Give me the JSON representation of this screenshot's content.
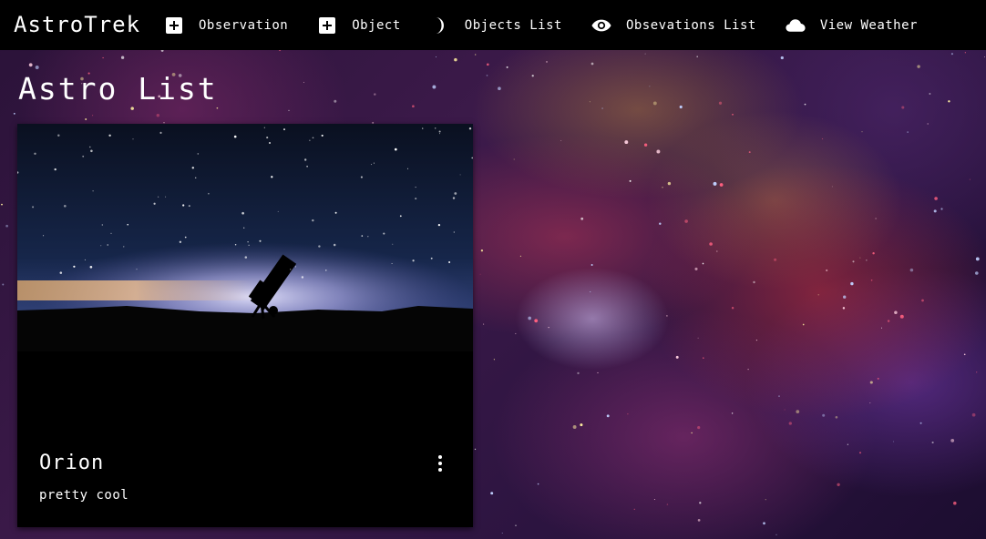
{
  "app": {
    "brand": "AstroTrek"
  },
  "nav": {
    "items": [
      {
        "label": "Observation",
        "icon": "plus-box-icon"
      },
      {
        "label": "Object",
        "icon": "plus-box-icon"
      },
      {
        "label": "Objects List",
        "icon": "moon-icon"
      },
      {
        "label": "Obsevations List",
        "icon": "eye-icon"
      },
      {
        "label": "View Weather",
        "icon": "cloud-icon"
      }
    ]
  },
  "main": {
    "title": "Astro List",
    "cards": [
      {
        "title": "Orion",
        "description": "pretty cool",
        "image": "telescope-silhouette-night-sky",
        "menu_icon": "more-vert-icon"
      }
    ]
  },
  "colors": {
    "nav_bg": "#000000",
    "card_bg": "#000000",
    "text": "#ffffff"
  }
}
